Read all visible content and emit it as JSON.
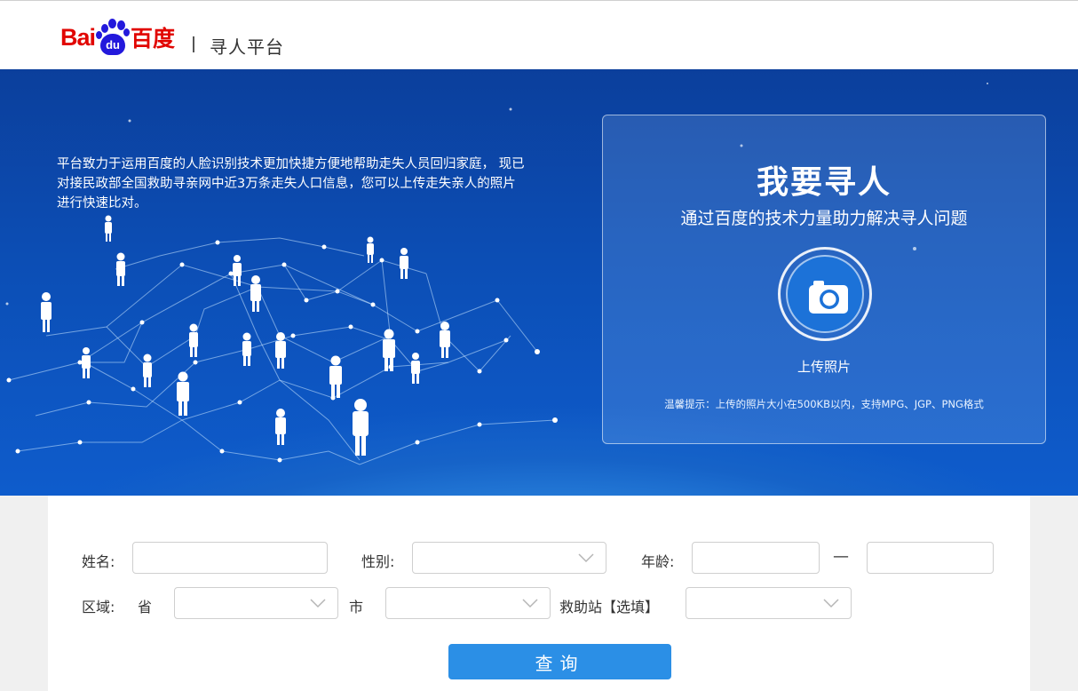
{
  "header": {
    "logo": {
      "bai": "Bai",
      "du": "du",
      "cn": "百度"
    },
    "title": "寻人平台"
  },
  "banner": {
    "description": "平台致力于运用百度的人脸识别技术更加快捷方便地帮助走失人员回归家庭，  现已对接民政部全国救助寻亲网中近3万条走失人口信息，您可以上传走失亲人的照片进行快速比对。",
    "panel": {
      "title": "我要寻人",
      "subtitle": "通过百度的技术力量助力解决寻人问题",
      "upload_icon": "camera-icon",
      "upload_label": "上传照片",
      "tip": "温馨提示：上传的照片大小在500KB以内，支持MPG、JGP、PNG格式"
    }
  },
  "form": {
    "name_label": "姓名:",
    "name_value": "",
    "gender_label": "性别:",
    "gender_value": "",
    "age_label": "年龄:",
    "age_min_value": "",
    "age_separator": "—",
    "age_max_value": "",
    "region_label": "区域:",
    "province_label": "省",
    "province_value": "",
    "city_label": "市",
    "city_value": "",
    "station_label": "救助站【选填】",
    "station_value": "",
    "submit_label": "查询"
  },
  "colors": {
    "brand_red": "#e10602",
    "brand_blue": "#2319dc",
    "button_blue": "#2b8fe6"
  }
}
